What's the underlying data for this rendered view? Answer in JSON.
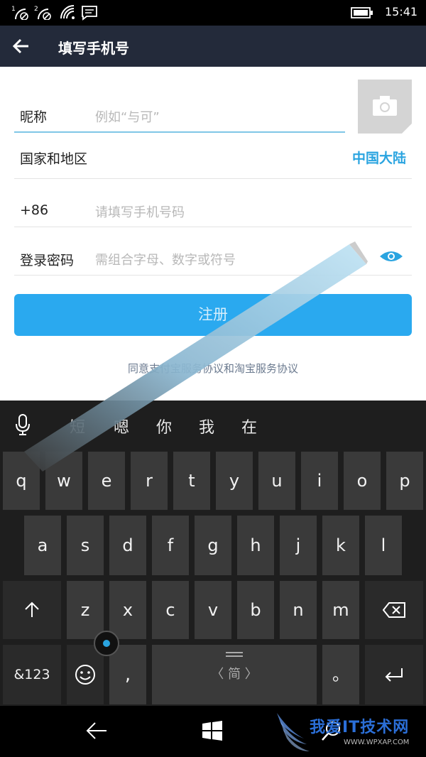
{
  "status_bar": {
    "sim1": "1",
    "sim2": "2",
    "time": "15:41"
  },
  "header": {
    "title": "填写手机号"
  },
  "form": {
    "nickname_label": "昵称",
    "nickname_placeholder": "例如“与可”",
    "region_label": "国家和地区",
    "region_value": "中国大陆",
    "phone_prefix": "+86",
    "phone_placeholder": "请填写手机号码",
    "password_label": "登录密码",
    "password_placeholder": "需组合字母、数字或符号",
    "register_label": "注册",
    "agreement_text": "同意支付宝服务协议和淘宝服务协议"
  },
  "keyboard": {
    "suggestions": [
      "短",
      "嗯",
      "你",
      "我",
      "在"
    ],
    "row1": [
      "q",
      "w",
      "e",
      "r",
      "t",
      "y",
      "u",
      "i",
      "o",
      "p"
    ],
    "row2": [
      "a",
      "s",
      "d",
      "f",
      "g",
      "h",
      "j",
      "k",
      "l"
    ],
    "row3": [
      "z",
      "x",
      "c",
      "v",
      "b",
      "n",
      "m"
    ],
    "symbols_label": "&123",
    "comma_label": ",",
    "space_label": "〈 简 〉",
    "period_label": "。"
  },
  "watermark": {
    "title": "我爱IT技术网",
    "sub": "WWW.WPXAP.COM"
  },
  "colors": {
    "accent": "#2aa9ef",
    "header_bg": "#232a3a",
    "link": "#2aa4e0"
  }
}
